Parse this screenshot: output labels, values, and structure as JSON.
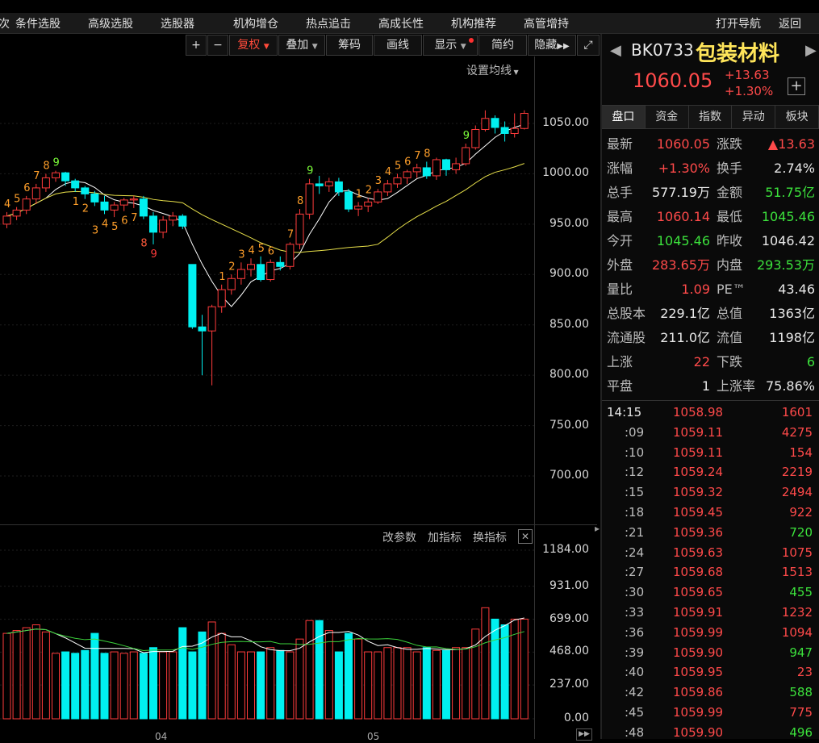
{
  "nav": {
    "items": [
      "条件选股",
      "高级选股",
      "选股器",
      "机构增仓",
      "热点追击",
      "高成长性",
      "机构推荐",
      "高管增持"
    ],
    "open_nav": "打开导航",
    "back": "返回",
    "left_clip": "次"
  },
  "toolbar": {
    "plus": "+",
    "minus": "−",
    "fuquan": "复权",
    "diejia": "叠加",
    "chouma": "筹码",
    "huaxian": "画线",
    "xianshi": "显示",
    "jianyue": "简约",
    "yincang": "隐藏"
  },
  "chart": {
    "set_ma": "设置均线",
    "price_axis": [
      "1050.00",
      "1000.00",
      "950.00",
      "900.00",
      "850.00",
      "800.00",
      "750.00",
      "700.00"
    ],
    "vol_axis": [
      "1184.00",
      "931.00",
      "699.00",
      "468.00",
      "237.00",
      "0.00"
    ],
    "indicator_btns": [
      "改参数",
      "加指标",
      "换指标"
    ],
    "month_labels": [
      "04",
      "05"
    ],
    "colors": {
      "up": "#ff3b3b",
      "down": "#00f0f0",
      "ma1": "#ffffff",
      "ma2": "#e8e04a"
    }
  },
  "chart_data": {
    "type": "candlestick",
    "ylim": [
      680,
      1070
    ],
    "candles": [
      [
        950,
        962,
        946,
        958
      ],
      [
        958,
        967,
        954,
        964
      ],
      [
        964,
        978,
        960,
        975
      ],
      [
        975,
        990,
        970,
        986
      ],
      [
        986,
        1000,
        982,
        996
      ],
      [
        996,
        1003,
        992,
        1001
      ],
      [
        1001,
        1002,
        988,
        993
      ],
      [
        993,
        995,
        982,
        986
      ],
      [
        986,
        988,
        975,
        980
      ],
      [
        980,
        983,
        968,
        972
      ],
      [
        972,
        978,
        960,
        964
      ],
      [
        964,
        972,
        957,
        969
      ],
      [
        969,
        976,
        963,
        974
      ],
      [
        974,
        978,
        966,
        975
      ],
      [
        975,
        978,
        955,
        958
      ],
      [
        958,
        962,
        930,
        942
      ],
      [
        942,
        958,
        936,
        954
      ],
      [
        954,
        962,
        948,
        958
      ],
      [
        958,
        960,
        945,
        948
      ],
      [
        910,
        910,
        846,
        848
      ],
      [
        848,
        860,
        800,
        844
      ],
      [
        844,
        870,
        790,
        868
      ],
      [
        868,
        890,
        862,
        885
      ],
      [
        885,
        900,
        880,
        896
      ],
      [
        896,
        912,
        890,
        905
      ],
      [
        905,
        916,
        898,
        910
      ],
      [
        910,
        918,
        893,
        895
      ],
      [
        895,
        915,
        893,
        912
      ],
      [
        912,
        918,
        904,
        908
      ],
      [
        908,
        932,
        905,
        930
      ],
      [
        930,
        965,
        925,
        960
      ],
      [
        960,
        995,
        955,
        990
      ],
      [
        990,
        998,
        980,
        988
      ],
      [
        988,
        996,
        982,
        992
      ],
      [
        992,
        996,
        978,
        982
      ],
      [
        982,
        985,
        962,
        965
      ],
      [
        965,
        972,
        958,
        968
      ],
      [
        968,
        976,
        962,
        972
      ],
      [
        972,
        985,
        970,
        982
      ],
      [
        982,
        994,
        978,
        990
      ],
      [
        990,
        1000,
        986,
        996
      ],
      [
        996,
        1004,
        990,
        1002
      ],
      [
        1002,
        1010,
        996,
        1006
      ],
      [
        1006,
        1012,
        995,
        998
      ],
      [
        998,
        1016,
        994,
        1014
      ],
      [
        1014,
        1015,
        998,
        1004
      ],
      [
        1004,
        1016,
        1000,
        1010
      ],
      [
        1010,
        1030,
        1008,
        1026
      ],
      [
        1026,
        1048,
        1024,
        1044
      ],
      [
        1044,
        1063,
        1042,
        1055
      ],
      [
        1055,
        1058,
        1040,
        1046
      ],
      [
        1046,
        1052,
        1032,
        1040
      ],
      [
        1040,
        1060,
        1036,
        1045
      ],
      [
        1045,
        1063,
        1044,
        1060
      ]
    ],
    "volumes": [
      600,
      620,
      640,
      660,
      610,
      460,
      470,
      460,
      480,
      600,
      460,
      470,
      460,
      470,
      460,
      500,
      470,
      470,
      640,
      470,
      610,
      680,
      600,
      520,
      470,
      470,
      470,
      500,
      480,
      470,
      560,
      690,
      690,
      620,
      470,
      600,
      560,
      470,
      470,
      500,
      500,
      500,
      470,
      500,
      480,
      480,
      500,
      500,
      630,
      780,
      700,
      660,
      700,
      700
    ],
    "td_labels": [
      {
        "i": 0,
        "t": "4",
        "c": "#ff9f2a",
        "pos": "above"
      },
      {
        "i": 1,
        "t": "5",
        "c": "#ff9f2a",
        "pos": "above"
      },
      {
        "i": 2,
        "t": "6",
        "c": "#ff9f2a",
        "pos": "above"
      },
      {
        "i": 3,
        "t": "7",
        "c": "#ff9f2a",
        "pos": "above"
      },
      {
        "i": 4,
        "t": "8",
        "c": "#ff9f2a",
        "pos": "above"
      },
      {
        "i": 5,
        "t": "9",
        "c": "#7cff3a",
        "pos": "above"
      },
      {
        "i": 7,
        "t": "1",
        "c": "#ff9f2a",
        "pos": "below"
      },
      {
        "i": 8,
        "t": "2",
        "c": "#ff9f2a",
        "pos": "below"
      },
      {
        "i": 9,
        "t": "3",
        "c": "#ff9f2a",
        "pos": "below2"
      },
      {
        "i": 10,
        "t": "4",
        "c": "#ff9f2a",
        "pos": "below"
      },
      {
        "i": 11,
        "t": "5",
        "c": "#ff9f2a",
        "pos": "below"
      },
      {
        "i": 12,
        "t": "6",
        "c": "#ff9f2a",
        "pos": "below"
      },
      {
        "i": 13,
        "t": "7",
        "c": "#ff9f2a",
        "pos": "below"
      },
      {
        "i": 14,
        "t": "8",
        "c": "#ff5a3a",
        "pos": "below2"
      },
      {
        "i": 15,
        "t": "9",
        "c": "#ff3b3b",
        "pos": "below"
      },
      {
        "i": 22,
        "t": "1",
        "c": "#ff9f2a",
        "pos": "above"
      },
      {
        "i": 23,
        "t": "2",
        "c": "#ff9f2a",
        "pos": "above"
      },
      {
        "i": 24,
        "t": "3",
        "c": "#ff9f2a",
        "pos": "above"
      },
      {
        "i": 25,
        "t": "4",
        "c": "#ff9f2a",
        "pos": "above"
      },
      {
        "i": 26,
        "t": "5",
        "c": "#ff9f2a",
        "pos": "above"
      },
      {
        "i": 27,
        "t": "6",
        "c": "#ff9f2a",
        "pos": "above"
      },
      {
        "i": 29,
        "t": "7",
        "c": "#ff9f2a",
        "pos": "above"
      },
      {
        "i": 30,
        "t": "8",
        "c": "#ff9f2a",
        "pos": "above"
      },
      {
        "i": 31,
        "t": "9",
        "c": "#7cff3a",
        "pos": "above"
      },
      {
        "i": 36,
        "t": "1",
        "c": "#ff9f2a",
        "pos": "above"
      },
      {
        "i": 37,
        "t": "2",
        "c": "#ff9f2a",
        "pos": "above"
      },
      {
        "i": 38,
        "t": "3",
        "c": "#ff9f2a",
        "pos": "above"
      },
      {
        "i": 39,
        "t": "4",
        "c": "#ff9f2a",
        "pos": "above"
      },
      {
        "i": 40,
        "t": "5",
        "c": "#ff9f2a",
        "pos": "above"
      },
      {
        "i": 41,
        "t": "6",
        "c": "#ff9f2a",
        "pos": "above"
      },
      {
        "i": 42,
        "t": "7",
        "c": "#ff9f2a",
        "pos": "above"
      },
      {
        "i": 43,
        "t": "8",
        "c": "#ff9f2a",
        "pos": "above"
      },
      {
        "i": 47,
        "t": "9",
        "c": "#7cff3a",
        "pos": "above"
      }
    ]
  },
  "quote": {
    "code": "BK0733",
    "name": "包装材料",
    "price": "1060.05",
    "change": "+13.63",
    "change_pct": "+1.30%",
    "tabs": [
      "盘口",
      "资金",
      "指数",
      "异动",
      "板块"
    ],
    "rows": [
      [
        {
          "k": "最新",
          "v": "1060.05",
          "c": "red"
        },
        {
          "k": "涨跌",
          "v": "▲13.63",
          "c": "red"
        }
      ],
      [
        {
          "k": "涨幅",
          "v": "+1.30%",
          "c": "red"
        },
        {
          "k": "换手",
          "v": "2.74%",
          "c": "white"
        }
      ],
      [
        {
          "k": "总手",
          "v": "577.19万",
          "c": "white"
        },
        {
          "k": "金额",
          "v": "51.75亿",
          "c": "green"
        }
      ],
      [
        {
          "k": "最高",
          "v": "1060.14",
          "c": "red"
        },
        {
          "k": "最低",
          "v": "1045.46",
          "c": "green"
        }
      ],
      [
        {
          "k": "今开",
          "v": "1045.46",
          "c": "green"
        },
        {
          "k": "昨收",
          "v": "1046.42",
          "c": "white"
        }
      ],
      [
        {
          "k": "外盘",
          "v": "283.65万",
          "c": "red"
        },
        {
          "k": "内盘",
          "v": "293.53万",
          "c": "green"
        }
      ],
      [
        {
          "k": "量比",
          "v": "1.09",
          "c": "red"
        },
        {
          "k": "PE™",
          "v": "43.46",
          "c": "white"
        }
      ],
      [
        {
          "k": "总股本",
          "v": "229.1亿",
          "c": "white"
        },
        {
          "k": "总值",
          "v": "1363亿",
          "c": "white"
        }
      ],
      [
        {
          "k": "流通股",
          "v": "211.0亿",
          "c": "white"
        },
        {
          "k": "流值",
          "v": "1198亿",
          "c": "white"
        }
      ],
      [
        {
          "k": "上涨",
          "v": "22",
          "c": "red"
        },
        {
          "k": "下跌",
          "v": "6",
          "c": "green"
        }
      ],
      [
        {
          "k": "平盘",
          "v": "1",
          "c": "white"
        },
        {
          "k": "上涨率",
          "v": "75.86%",
          "c": "white"
        }
      ]
    ],
    "ticks": [
      {
        "t": "14:15",
        "p": "1058.98",
        "v": "1601",
        "vc": "red"
      },
      {
        "t": ":09",
        "p": "1059.11",
        "v": "4275",
        "vc": "red"
      },
      {
        "t": ":10",
        "p": "1059.11",
        "v": "154",
        "vc": "red"
      },
      {
        "t": ":12",
        "p": "1059.24",
        "v": "2219",
        "vc": "red"
      },
      {
        "t": ":15",
        "p": "1059.32",
        "v": "2494",
        "vc": "red"
      },
      {
        "t": ":18",
        "p": "1059.45",
        "v": "922",
        "vc": "red"
      },
      {
        "t": ":21",
        "p": "1059.36",
        "v": "720",
        "vc": "green"
      },
      {
        "t": ":24",
        "p": "1059.63",
        "v": "1075",
        "vc": "red"
      },
      {
        "t": ":27",
        "p": "1059.68",
        "v": "1513",
        "vc": "red"
      },
      {
        "t": ":30",
        "p": "1059.65",
        "v": "455",
        "vc": "green"
      },
      {
        "t": ":33",
        "p": "1059.91",
        "v": "1232",
        "vc": "red"
      },
      {
        "t": ":36",
        "p": "1059.99",
        "v": "1094",
        "vc": "red"
      },
      {
        "t": ":39",
        "p": "1059.90",
        "v": "947",
        "vc": "green"
      },
      {
        "t": ":40",
        "p": "1059.95",
        "v": "23",
        "vc": "red"
      },
      {
        "t": ":42",
        "p": "1059.86",
        "v": "588",
        "vc": "green"
      },
      {
        "t": ":45",
        "p": "1059.99",
        "v": "775",
        "vc": "red"
      },
      {
        "t": ":48",
        "p": "1059.90",
        "v": "496",
        "vc": "green"
      }
    ]
  }
}
